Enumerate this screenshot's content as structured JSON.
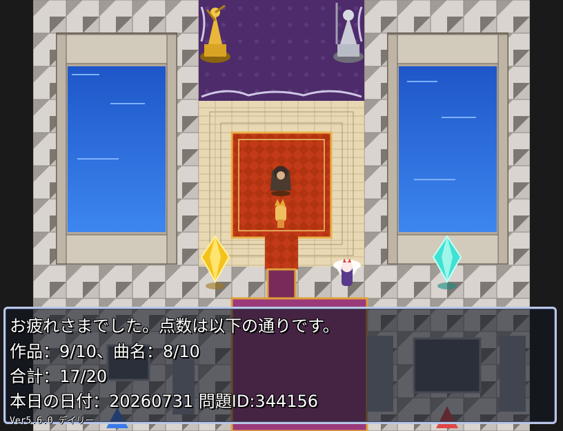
{
  "message": {
    "lines": [
      "お疲れさまでした。点数は以下の通りです。",
      "作品：9/10、曲名：8/10",
      "合計：17/20",
      "本日の日付：20260731 問題ID:344156"
    ]
  },
  "version_label": "Ver5.6.0 デイリー",
  "colors": {
    "floor_light": "#d9d4cf",
    "floor_dark": "#7d7772",
    "water": "#2f6fe0",
    "carpet_red": "#c23a18",
    "carpet_purple": "#5a2f6b",
    "crystal_yellow": "#f4c21c",
    "crystal_cyan": "#3fe2d2"
  }
}
